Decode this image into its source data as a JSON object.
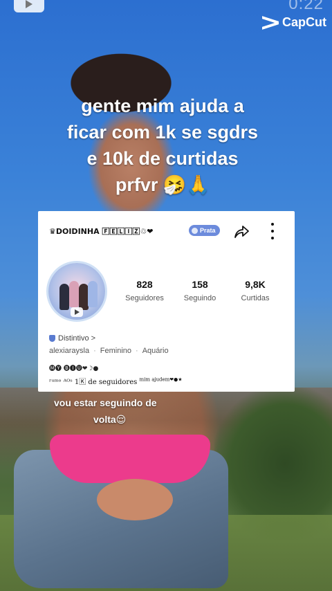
{
  "overlay": {
    "timer": "0:22",
    "watermark": "CapCut"
  },
  "caption": {
    "lines": [
      "gente mim ajuda a",
      "ficar com 1k se sgdrs",
      "e 10k de curtidas",
      "prfvr 🤧🙏"
    ]
  },
  "profile_card": {
    "name": "♛DOIDINHA 🄵🄴🄻🄸🅉♲❤",
    "level_badge": "Prata",
    "stats": [
      {
        "value": "828",
        "label": "Seguidores"
      },
      {
        "value": "158",
        "label": "Seguindo"
      },
      {
        "value": "9,8K",
        "label": "Curtidas"
      }
    ],
    "badge_link": "Distintivo >",
    "username": "alexiaraysla",
    "gender": "Feminino",
    "sign": "Aquário",
    "bio_line1": "🅜🅨 🅑🅘🅤❤☽●",
    "bio_line2": "ʳᵘᵐᵒ ᴬᴼˢ 1🄺 de seguidores",
    "bio_line2_sup": "mim ajudem❤●★"
  },
  "sub_caption": {
    "line1": "vou estar seguindo de",
    "line2": "volta😌"
  }
}
